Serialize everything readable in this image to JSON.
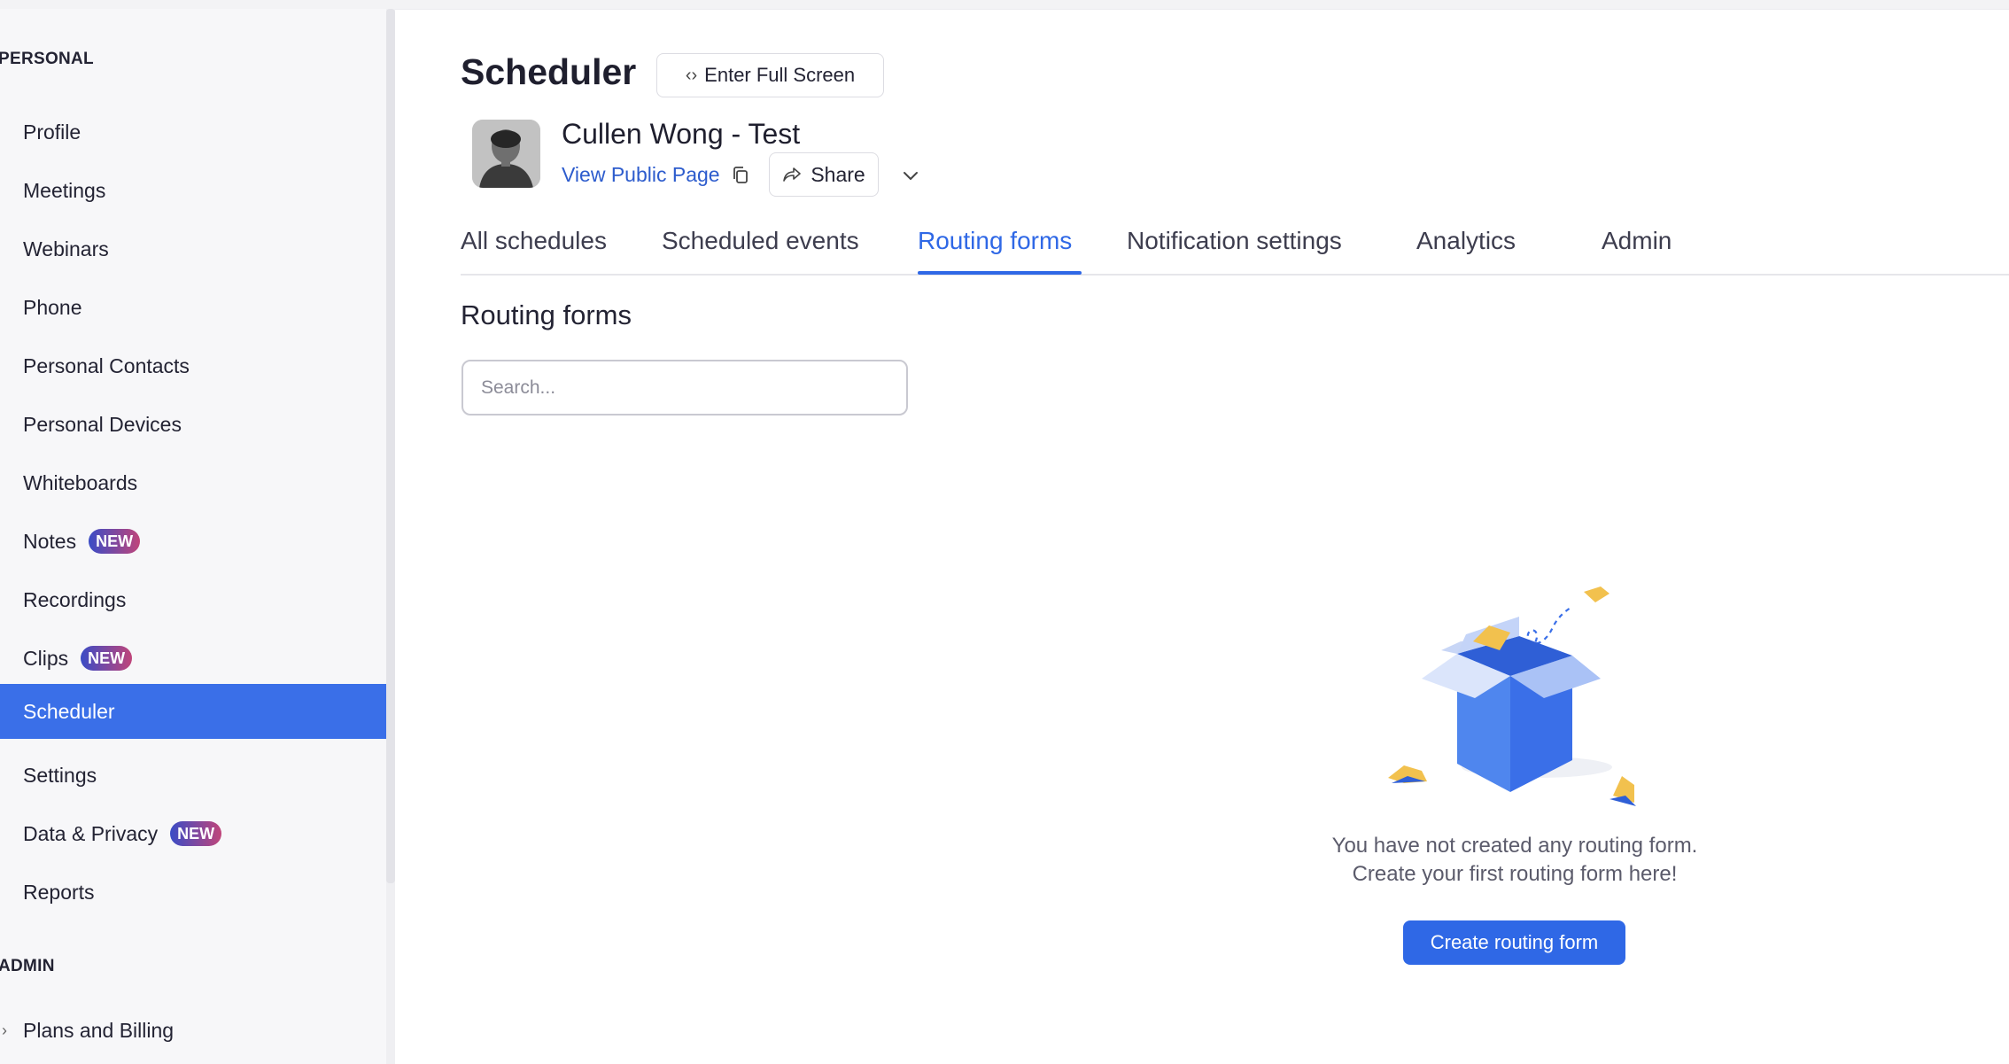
{
  "sidebar": {
    "personal_label": "PERSONAL",
    "admin_label": "ADMIN",
    "items": [
      {
        "label": "Profile"
      },
      {
        "label": "Meetings"
      },
      {
        "label": "Webinars"
      },
      {
        "label": "Phone"
      },
      {
        "label": "Personal Contacts"
      },
      {
        "label": "Personal Devices"
      },
      {
        "label": "Whiteboards"
      },
      {
        "label": "Notes",
        "badge": "NEW"
      },
      {
        "label": "Recordings"
      },
      {
        "label": "Clips",
        "badge": "NEW"
      },
      {
        "label": "Scheduler",
        "active": true
      },
      {
        "label": "Settings"
      },
      {
        "label": "Data & Privacy",
        "badge": "NEW"
      },
      {
        "label": "Reports"
      }
    ],
    "admin_items": [
      {
        "label": "Plans and Billing",
        "icon": "chevron-right-icon"
      }
    ]
  },
  "header": {
    "title": "Scheduler",
    "fullscreen_label": "Enter Full Screen",
    "fullscreen_icon": "code-brackets-icon"
  },
  "profile": {
    "name": "Cullen Wong - Test",
    "public_page_label": "View Public Page",
    "share_label": "Share"
  },
  "tabs": [
    {
      "label": "All schedules"
    },
    {
      "label": "Scheduled events"
    },
    {
      "label": "Routing forms",
      "active": true
    },
    {
      "label": "Notification settings"
    },
    {
      "label": "Analytics"
    },
    {
      "label": "Admin"
    }
  ],
  "routing": {
    "section_title": "Routing forms",
    "search_placeholder": "Search...",
    "empty_line1": "You have not created any routing form.",
    "empty_line2": "Create your first routing form here!",
    "create_button": "Create routing form"
  },
  "colors": {
    "accent": "#2f68e6",
    "active_nav": "#3a6fe8",
    "sidebar_bg": "#f7f7f9"
  }
}
